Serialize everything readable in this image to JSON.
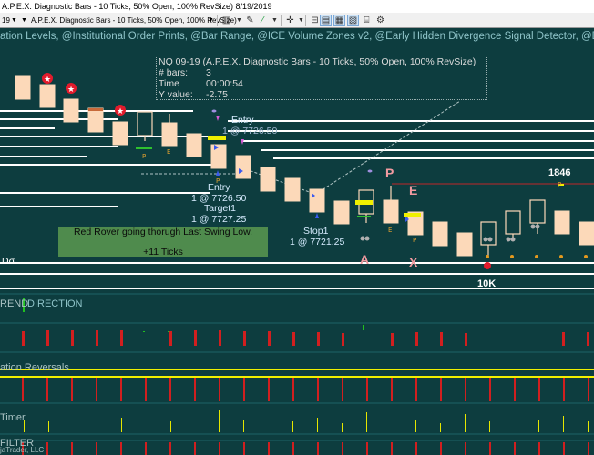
{
  "window": {
    "title": "A.P.E.X. Diagnostic Bars - 10 Ticks, 50% Open, 100% RevSize)  8/19/2019"
  },
  "toolbar": {
    "instrument_fragment": "19",
    "chart_label": "A.P.E.X. Diagnostic Bars - 10 Ticks, 50% Open, 100% RevSize)",
    "icons": [
      "dropdown-arrow-icon",
      "bar-style-icon",
      "draw-pencil-icon",
      "magic-wand-icon",
      "crosshair-icon",
      "properties-icon",
      "data-box-icon",
      "templates-icon",
      "indicators-icon",
      "strategies-icon"
    ]
  },
  "indicator_header": "ation Levels, @Institutional Order Prints, @Bar Range, @ICE Volume Zones v2, @Early Hidden Divergence Signal Detector, @Early Hidden",
  "infobox": {
    "line1": "NQ 09-19 (A.P.E.X. Diagnostic Bars - 10 Ticks, 50% Open, 100% RevSize)",
    "rows": [
      {
        "key": "# bars:",
        "value": "3"
      },
      {
        "key": "Time",
        "value": "00:00:54"
      },
      {
        "key": "Y value:",
        "value": "-2.75"
      }
    ]
  },
  "annotations": {
    "entry_top": "Entry",
    "entry_top_price": "1 @ 7726.50",
    "entry_low": "Entry",
    "entry_low_price": "1 @ 7726.50",
    "target": "Target1",
    "target_price": "1 @ 7727.25",
    "stop": "Stop1",
    "stop_price": "1 @ 7721.25",
    "level_1846": "1846",
    "marker_a": "A",
    "marker_x": "X",
    "marker_p": "P",
    "marker_e": "E",
    "tenk": "10K",
    "left_edge": "Dσ"
  },
  "note": {
    "line1": "Red Rover going thorugh Last Swing Low.",
    "line2": "+11 Ticks"
  },
  "panels": {
    "trend_prefix": "REND",
    "trend_word": "DIRECTION",
    "reversals": "ation Reversals",
    "timer": "Timer",
    "filter": "FILTER",
    "copyright": "jaTrader, LLC"
  },
  "colors": {
    "background": "#0d3d3f",
    "candle": "#fcd9b9",
    "grid": "#1d6367",
    "white_line": "#ffffff",
    "yellow_line": "#f1f100",
    "red_bar": "#d11f1f"
  }
}
